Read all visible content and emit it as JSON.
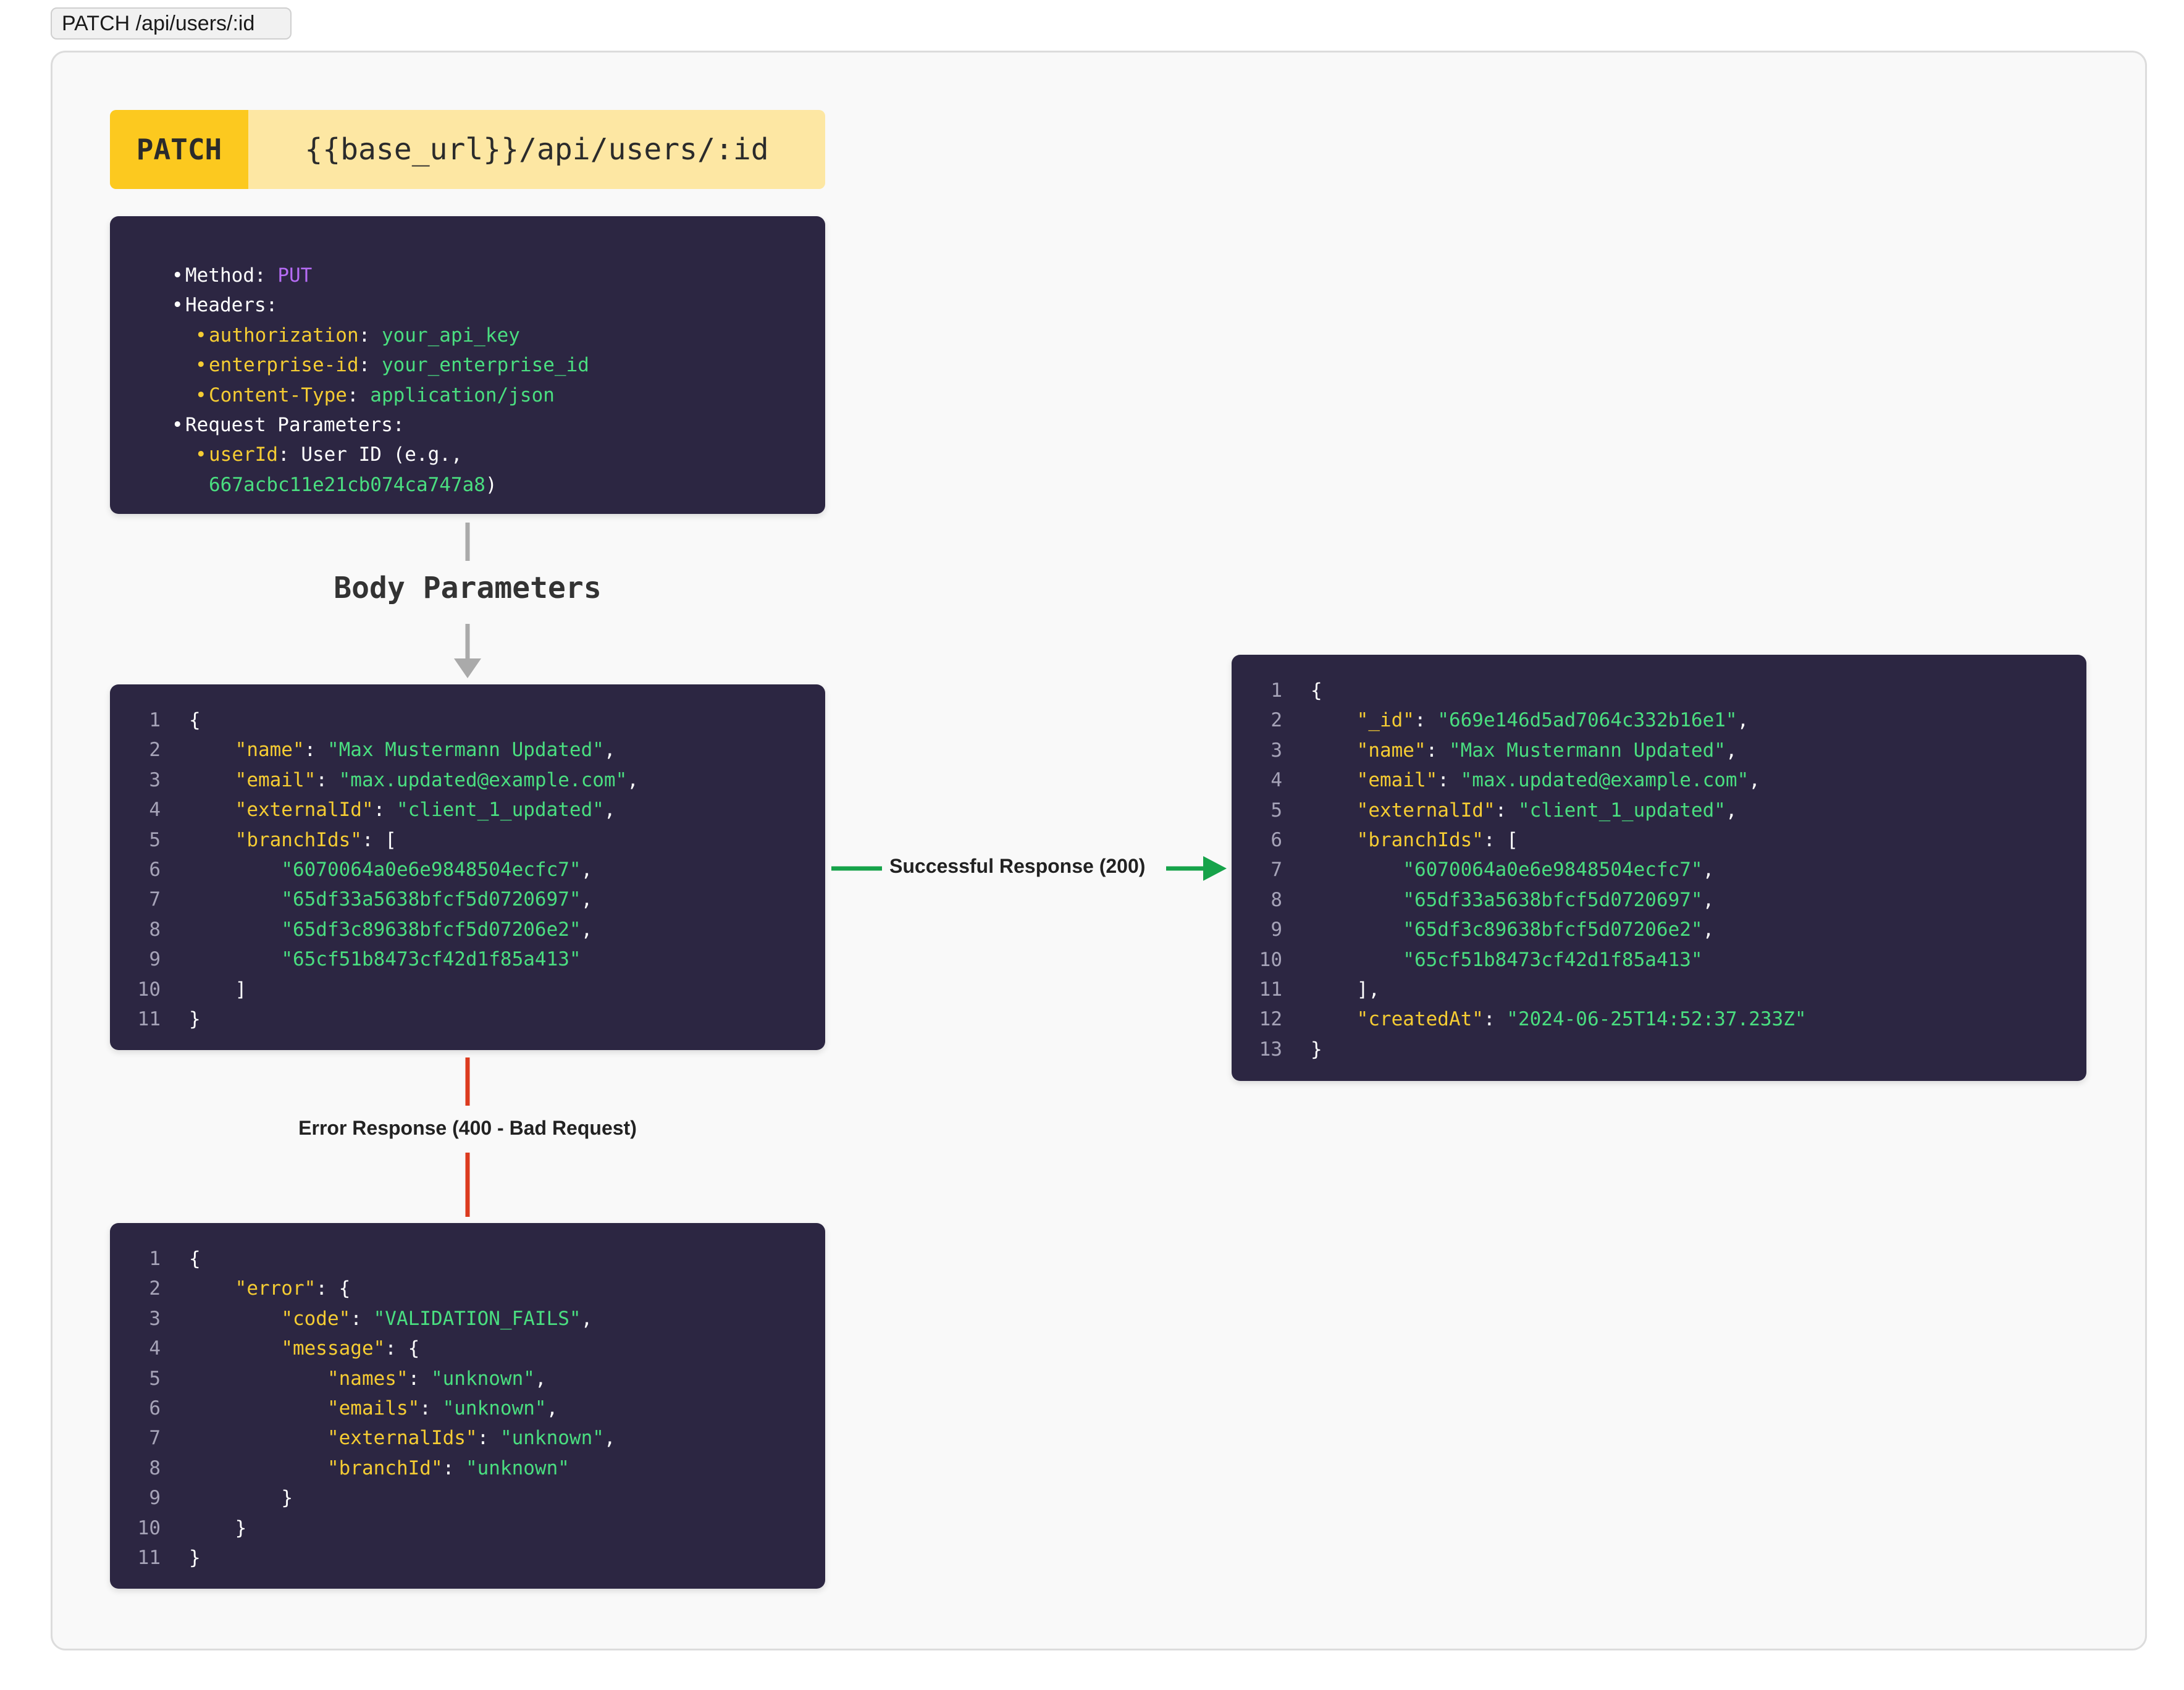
{
  "tab": {
    "label": "PATCH /api/users/:id"
  },
  "endpoint": {
    "method": "PATCH",
    "url": "{{base_url}}/api/users/:id"
  },
  "info": {
    "method_label": "Method",
    "method_value": "PUT",
    "headers_label": "Headers",
    "headers": [
      {
        "key": "authorization",
        "value": "your_api_key"
      },
      {
        "key": "enterprise-id",
        "value": "your_enterprise_id"
      },
      {
        "key": "Content-Type",
        "value": "application/json"
      }
    ],
    "params_label": "Request Parameters",
    "param_key": "userId",
    "param_desc": "User ID (e.g.,",
    "param_example": "667acbc11e21cb074ca747a8"
  },
  "labels": {
    "body": "Body Parameters",
    "success": "Successful Response (200)",
    "error": "Error Response (400 - Bad Request)"
  },
  "body_code": {
    "line_numbers": [
      "1",
      "2",
      "3",
      "4",
      "5",
      "6",
      "7",
      "8",
      "9",
      "10",
      "11"
    ],
    "name_key": "\"name\"",
    "name_value": "\"Max Mustermann Updated\"",
    "email_key": "\"email\"",
    "email_value": "\"max.updated@example.com\"",
    "external_key": "\"externalId\"",
    "external_value": "\"client_1_updated\"",
    "branch_key": "\"branchIds\"",
    "branch_ids": [
      "\"6070064a0e6e9848504ecfc7\"",
      "\"65df33a5638bfcf5d0720697\"",
      "\"65df3c89638bfcf5d07206e2\"",
      "\"65cf51b8473cf42d1f85a413\""
    ]
  },
  "response_code": {
    "line_numbers": [
      "1",
      "2",
      "3",
      "4",
      "5",
      "6",
      "7",
      "8",
      "9",
      "10",
      "11",
      "12",
      "13"
    ],
    "id_key": "\"_id\"",
    "id_value": "\"669e146d5ad7064c332b16e1\"",
    "name_key": "\"name\"",
    "name_value": "\"Max Mustermann Updated\"",
    "email_key": "\"email\"",
    "email_value": "\"max.updated@example.com\"",
    "external_key": "\"externalId\"",
    "external_value": "\"client_1_updated\"",
    "branch_key": "\"branchIds\"",
    "branch_ids": [
      "\"6070064a0e6e9848504ecfc7\"",
      "\"65df33a5638bfcf5d0720697\"",
      "\"65df3c89638bfcf5d07206e2\"",
      "\"65cf51b8473cf42d1f85a413\""
    ],
    "created_key": "\"createdAt\"",
    "created_value": "\"2024-06-25T14:52:37.233Z\""
  },
  "error_code": {
    "line_numbers": [
      "1",
      "2",
      "3",
      "4",
      "5",
      "6",
      "7",
      "8",
      "9",
      "10",
      "11"
    ],
    "error_key": "\"error\"",
    "code_key": "\"code\"",
    "code_value": "\"VALIDATION_FAILS\"",
    "message_key": "\"message\"",
    "names_key": "\"names\"",
    "names_value": "\"unknown\"",
    "emails_key": "\"emails\"",
    "emails_value": "\"unknown\"",
    "externals_key": "\"externalIds\"",
    "externals_value": "\"unknown\"",
    "branch_key": "\"branchId\"",
    "branch_value": "\"unknown\""
  },
  "colors": {
    "method_badge": "#fcc91f",
    "url_bar": "#fde7a3",
    "panel_bg": "#2c2642",
    "key": "#f5cc33",
    "string": "#4ade80",
    "method_value": "#b66cf5",
    "success_arrow": "#16a34a",
    "error_line": "#dc3b1f",
    "flow_arrow": "#aaaaaa"
  }
}
